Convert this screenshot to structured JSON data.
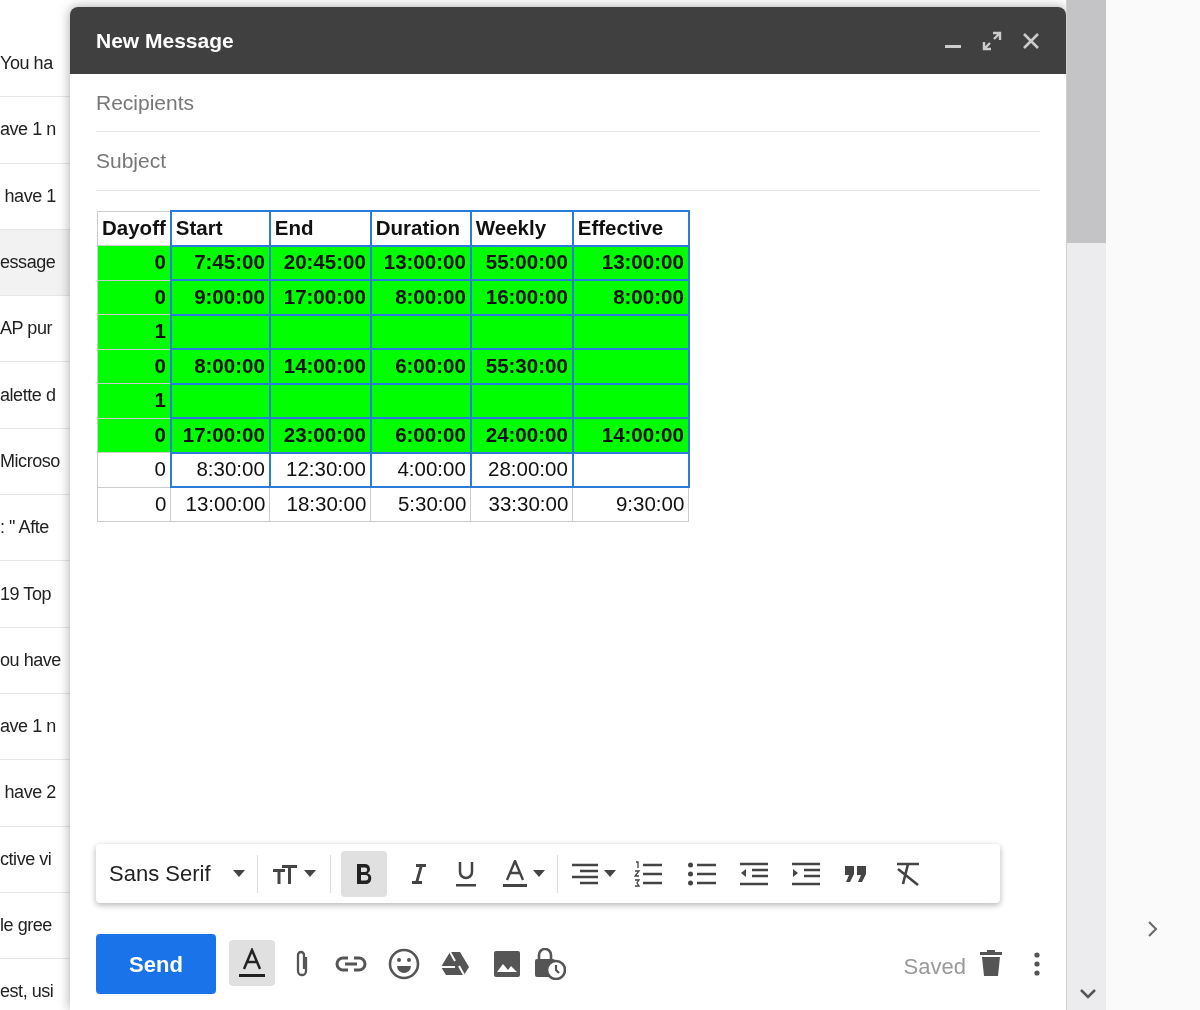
{
  "background_list": {
    "snippets": [
      {
        "text": "You ha",
        "selected": false
      },
      {
        "text": "ave 1 n",
        "selected": false
      },
      {
        "text": " have 1",
        "selected": false
      },
      {
        "text": "essage",
        "selected": true
      },
      {
        "text": "AP pur",
        "selected": false
      },
      {
        "text": "alette d",
        "selected": false
      },
      {
        "text": "Microso",
        "selected": false
      },
      {
        "text": ": \" Afte",
        "selected": false
      },
      {
        "text": "19 Top",
        "selected": false
      },
      {
        "text": "ou have",
        "selected": false
      },
      {
        "text": "ave 1 n",
        "selected": false
      },
      {
        "text": " have 2",
        "selected": false
      },
      {
        "text": "ctive vi",
        "selected": false
      },
      {
        "text": "le gree",
        "selected": false
      },
      {
        "text": "est, usi",
        "selected": false
      }
    ]
  },
  "compose": {
    "title": "New Message",
    "recipients_placeholder": "Recipients",
    "subject_placeholder": "Subject",
    "table": {
      "columns": [
        {
          "label": "Dayoff",
          "selected": false
        },
        {
          "label": "Start",
          "selected": true
        },
        {
          "label": "End",
          "selected": true
        },
        {
          "label": "Duration",
          "selected": true
        },
        {
          "label": "Weekly",
          "selected": true
        },
        {
          "label": "Effective",
          "selected": true
        }
      ],
      "rows": [
        {
          "highlighted": true,
          "selected": true,
          "cells": [
            "0",
            "7:45:00",
            "20:45:00",
            "13:00:00",
            "55:00:00",
            "13:00:00"
          ]
        },
        {
          "highlighted": true,
          "selected": true,
          "cells": [
            "0",
            "9:00:00",
            "17:00:00",
            "8:00:00",
            "16:00:00",
            "8:00:00"
          ]
        },
        {
          "highlighted": true,
          "selected": true,
          "cells": [
            "1",
            "",
            "",
            "",
            "",
            ""
          ]
        },
        {
          "highlighted": true,
          "selected": true,
          "cells": [
            "0",
            "8:00:00",
            "14:00:00",
            "6:00:00",
            "55:30:00",
            ""
          ]
        },
        {
          "highlighted": true,
          "selected": true,
          "cells": [
            "1",
            "",
            "",
            "",
            "",
            ""
          ]
        },
        {
          "highlighted": true,
          "selected": true,
          "cells": [
            "0",
            "17:00:00",
            "23:00:00",
            "6:00:00",
            "24:00:00",
            "14:00:00"
          ]
        },
        {
          "highlighted": false,
          "selected": true,
          "cells": [
            "0",
            "8:30:00",
            "12:30:00",
            "4:00:00",
            "28:00:00",
            ""
          ]
        },
        {
          "highlighted": false,
          "selected": false,
          "cells": [
            "0",
            "13:00:00",
            "18:30:00",
            "5:30:00",
            "33:30:00",
            "9:30:00"
          ]
        }
      ]
    },
    "format_bar": {
      "font": "Sans Serif",
      "bold_on": true
    },
    "send_label": "Send",
    "formatting_on": true,
    "status": "Saved"
  }
}
